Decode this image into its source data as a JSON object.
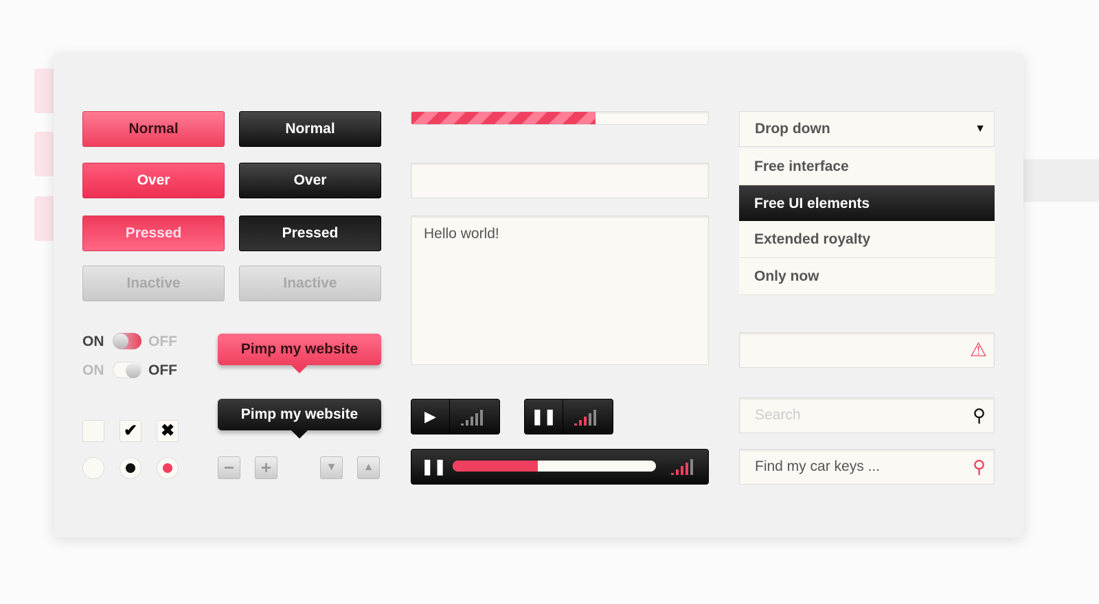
{
  "colors": {
    "accent": "#f0405f",
    "dark": "#1a1a1a",
    "field": "#fbf9f3",
    "panel": "#f1f1f1"
  },
  "buttons": {
    "pink": [
      "Normal",
      "Over",
      "Pressed",
      "Inactive"
    ],
    "dark": [
      "Normal",
      "Over",
      "Pressed",
      "Inactive"
    ]
  },
  "toggles": [
    {
      "on": "ON",
      "off": "OFF",
      "state": "on"
    },
    {
      "on": "ON",
      "off": "OFF",
      "state": "off"
    }
  ],
  "checkboxes": [
    "unchecked",
    "checked",
    "crossed"
  ],
  "radios": [
    "empty",
    "black-selected",
    "pink-selected"
  ],
  "tooltips": [
    "Pimp my website",
    "Pimp my website"
  ],
  "steppers": {
    "minus": "−",
    "plus": "+",
    "down": "down-arrow-icon",
    "up": "up-arrow-icon"
  },
  "progress_percent": 62,
  "text_input": {
    "value": ""
  },
  "textarea": {
    "value": "Hello world!"
  },
  "players": [
    {
      "button": "play-icon",
      "volume_level": 0,
      "volume_bars": 5
    },
    {
      "button": "pause-icon",
      "volume_level": 3,
      "volume_bars": 5
    },
    {
      "button": "pause-icon",
      "seek_percent": 42,
      "volume_level": 4,
      "volume_bars": 5
    }
  ],
  "dropdown": {
    "selected": "Drop down",
    "options": [
      "Free interface",
      "Free UI elements",
      "Extended royalty",
      "Only now"
    ],
    "highlighted": 1
  },
  "error_input": {
    "value": "",
    "icon": "warning-icon"
  },
  "search": {
    "placeholder": "Search"
  },
  "search2": {
    "value": "Find my car keys ..."
  }
}
